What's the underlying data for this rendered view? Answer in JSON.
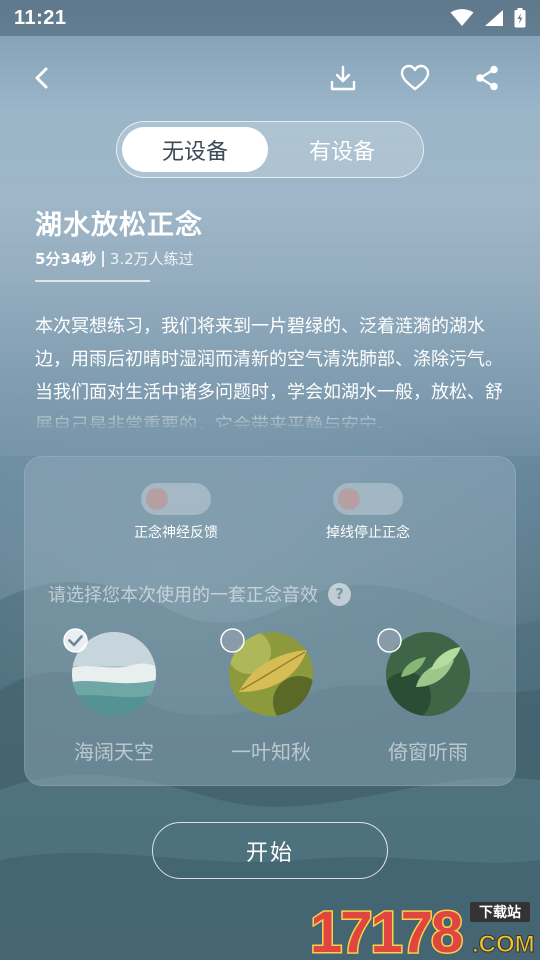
{
  "status_bar": {
    "time": "11:21"
  },
  "header": {
    "back_icon": "back-arrow-icon",
    "download_icon": "download-icon",
    "favorite_icon": "heart-icon",
    "share_icon": "share-icon"
  },
  "device_tabs": [
    {
      "label": "无设备",
      "active": true
    },
    {
      "label": "有设备",
      "active": false
    }
  ],
  "meditation": {
    "title": "湖水放松正念",
    "duration": "5分34秒",
    "practitioners": "3.2万人练过",
    "description": "本次冥想练习，我们将来到一片碧绿的、泛着涟漪的湖水边，用雨后初晴时湿润而清新的空气清洗肺部、涤除污气。当我们面对生活中诸多问题时，学会如湖水一般，放松、舒展自己是非常重要的，它会带来平静与安宁。"
  },
  "settings": {
    "toggles": [
      {
        "label": "正念神经反馈",
        "on": false
      },
      {
        "label": "掉线停止正念",
        "on": false
      }
    ],
    "prompt": "请选择您本次使用的一套正念音效",
    "help_symbol": "?",
    "sounds": [
      {
        "name": "海阔天空",
        "selected": true
      },
      {
        "name": "一叶知秋",
        "selected": false
      },
      {
        "name": "倚窗听雨",
        "selected": false
      }
    ]
  },
  "start_label": "开始",
  "watermark": {
    "number": "17178",
    "suffix": ".COM",
    "tag": "下载站"
  },
  "colors": {
    "active_tab_text": "#3b4a55",
    "toggle_knob": "#be9696"
  }
}
